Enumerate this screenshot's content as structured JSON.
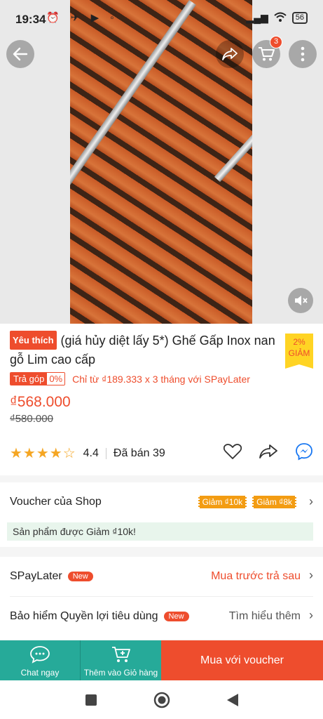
{
  "status_bar": {
    "time": "19:34",
    "icons_left": "⏰ ✈ ▶ ◦",
    "signal": "▂▄▆",
    "battery": "56"
  },
  "header": {
    "cart_count": "3"
  },
  "product": {
    "badge": "Yêu thích",
    "title": "(giá hủy diệt lấy 5*) Ghế Gấp Inox nan gỗ Lim cao cấp",
    "discount_percent": "2%",
    "discount_label": "GIẢM",
    "installment_label": "Trả góp",
    "installment_rate": "0%",
    "installment_text": "Chỉ từ ₫189.333 x 3 tháng với SPayLater",
    "price": "₫568.000",
    "old_price": "₫580.000",
    "rating": "4.4",
    "rating_value": 4.4,
    "sold": "Đã bán 39"
  },
  "voucher": {
    "label": "Voucher của Shop",
    "tags": [
      "Giảm ₫10k",
      "Giảm ₫8k"
    ],
    "note": "Sản phẩm được Giảm ₫10k!"
  },
  "spaylater": {
    "label": "SPayLater",
    "new": "New",
    "action": "Mua trước trả sau"
  },
  "insurance": {
    "label": "Bảo hiểm Quyền lợi tiêu dùng",
    "new": "New",
    "action": "Tìm hiểu thêm"
  },
  "bottom_bar": {
    "chat": "Chat ngay",
    "add_cart": "Thêm vào Giỏ hàng",
    "buy": "Mua với voucher"
  },
  "colors": {
    "accent": "#ee4d2d",
    "teal": "#26aa99",
    "star": "#f5a623"
  }
}
